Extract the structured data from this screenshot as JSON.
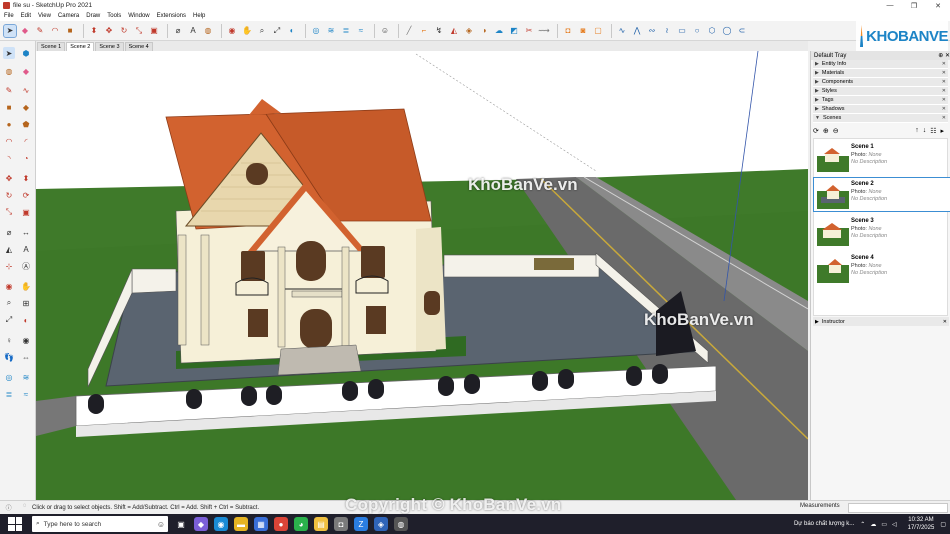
{
  "window": {
    "title": "file su - SketchUp Pro 2021",
    "min": "—",
    "max": "❐",
    "close": "✕"
  },
  "menu": [
    "File",
    "Edit",
    "View",
    "Camera",
    "Draw",
    "Tools",
    "Window",
    "Extensions",
    "Help"
  ],
  "logo": {
    "text": "KHOBANVE"
  },
  "scene_tabs": [
    "Scene 1",
    "Scene 2",
    "Scene 3",
    "Scene 4"
  ],
  "active_scene_tab": 1,
  "watermarks": [
    "KhoBanVe.vn",
    "KhoBanVe.vn"
  ],
  "copyright": "Copyright © KhoBanVe.vn",
  "tray": {
    "title": "Default Tray",
    "pin": "⊕ ✕",
    "sections": [
      "Entity Info",
      "Materials",
      "Components",
      "Styles",
      "Tags",
      "Shadows",
      "Scenes"
    ],
    "scenes": [
      {
        "name": "Scene 1",
        "photo_label": "Photo:",
        "photo_value": "None",
        "description": "No Description"
      },
      {
        "name": "Scene 2",
        "photo_label": "Photo:",
        "photo_value": "None",
        "description": "No Description"
      },
      {
        "name": "Scene 3",
        "photo_label": "Photo:",
        "photo_value": "None",
        "description": "No Description"
      },
      {
        "name": "Scene 4",
        "photo_label": "Photo:",
        "photo_value": "None",
        "description": "No Description"
      }
    ],
    "instructor": "Instructor"
  },
  "status": {
    "hint": "Click or drag to select objects. Shift = Add/Subtract. Ctrl = Add. Shift + Ctrl = Subtract.",
    "measurements_label": "Measurements"
  },
  "taskbar": {
    "search_placeholder": "Type here to search",
    "weather": "Dự báo chất lượng k...",
    "time": "10:32 AM",
    "date": "17/7/2025"
  },
  "colors": {
    "grass": "#3f7a2a",
    "roof": "#d2622f",
    "walls": "#f6f0d8",
    "paving": "#5a6470",
    "sky": "#ffffff",
    "road": "#6a6a6a",
    "accent": "#1d84c6"
  }
}
